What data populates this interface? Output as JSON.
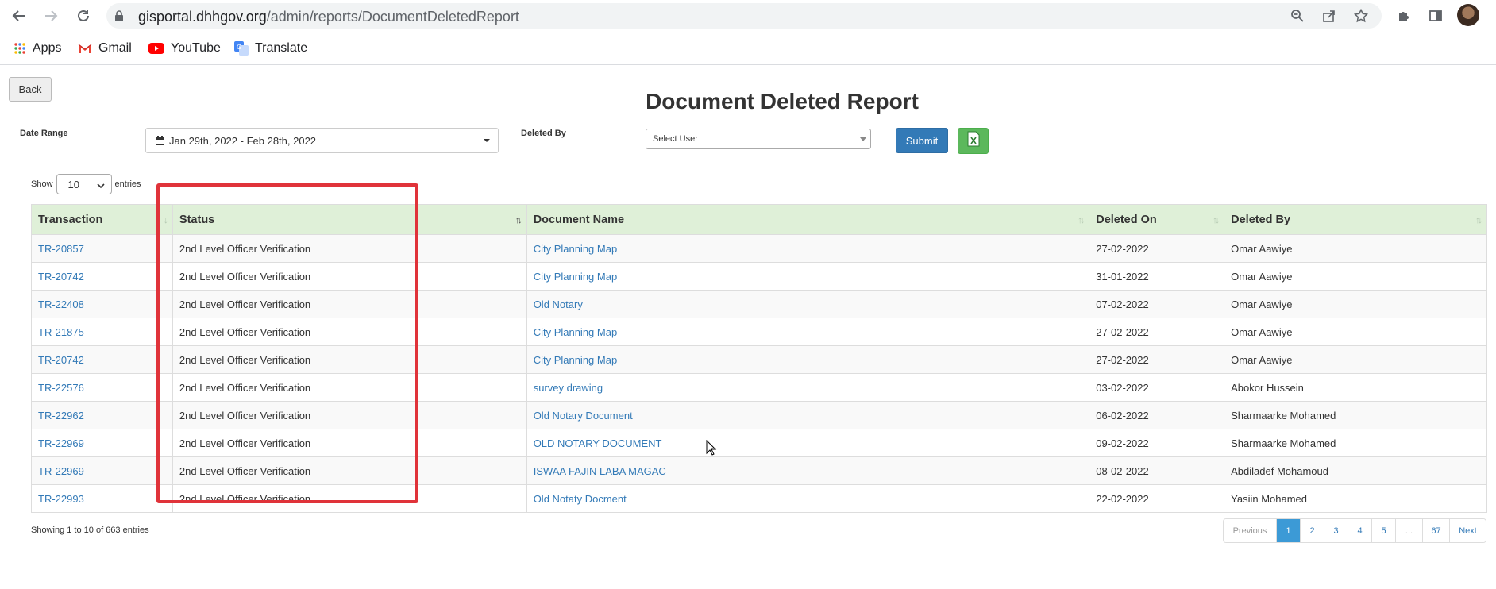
{
  "browser": {
    "url_host": "gisportal.dhhgov.org",
    "url_path": "/admin/reports/DocumentDeletedReport",
    "bookmarks": [
      {
        "label": "Apps",
        "icon": "apps-grid-icon"
      },
      {
        "label": "Gmail",
        "icon": "gmail-icon"
      },
      {
        "label": "YouTube",
        "icon": "youtube-icon"
      },
      {
        "label": "Translate",
        "icon": "translate-icon"
      }
    ]
  },
  "page": {
    "back_label": "Back",
    "title": "Document Deleted Report",
    "date_range_label": "Date Range",
    "date_range_value": "Jan 29th, 2022 - Feb 28th, 2022",
    "deleted_by_label": "Deleted By",
    "deleted_by_select": "Select User",
    "submit_label": "Submit",
    "excel_icon": "excel-export-icon"
  },
  "table": {
    "show_label": "Show",
    "page_length": "10",
    "entries_label": "entries",
    "columns": [
      "Transaction",
      "Status",
      "Document Name",
      "Deleted On",
      "Deleted By"
    ],
    "rows": [
      [
        "TR-20857",
        "2nd Level Officer Verification",
        "City Planning Map",
        "27-02-2022",
        "Omar Aawiye"
      ],
      [
        "TR-20742",
        "2nd Level Officer Verification",
        "City Planning Map",
        "31-01-2022",
        "Omar Aawiye"
      ],
      [
        "TR-22408",
        "2nd Level Officer Verification",
        "Old Notary",
        "07-02-2022",
        "Omar Aawiye"
      ],
      [
        "TR-21875",
        "2nd Level Officer Verification",
        "City Planning Map",
        "27-02-2022",
        "Omar Aawiye"
      ],
      [
        "TR-20742",
        "2nd Level Officer Verification",
        "City Planning Map",
        "27-02-2022",
        "Omar Aawiye"
      ],
      [
        "TR-22576",
        "2nd Level Officer Verification",
        "survey drawing",
        "03-02-2022",
        "Abokor Hussein"
      ],
      [
        "TR-22962",
        "2nd Level Officer Verification",
        "Old Notary Document",
        "06-02-2022",
        "Sharmaarke Mohamed"
      ],
      [
        "TR-22969",
        "2nd Level Officer Verification",
        "OLD NOTARY DOCUMENT",
        "09-02-2022",
        "Sharmaarke Mohamed"
      ],
      [
        "TR-22969",
        "2nd Level Officer Verification",
        "ISWAA FAJIN LABA MAGAC",
        "08-02-2022",
        "Abdiladef Mohamoud"
      ],
      [
        "TR-22993",
        "2nd Level Officer Verification",
        "Old Notaty Docment",
        "22-02-2022",
        "Yasiin Mohamed"
      ]
    ],
    "info": "Showing 1 to 10 of 663 entries",
    "pagination": [
      "Previous",
      "1",
      "2",
      "3",
      "4",
      "5",
      "...",
      "67",
      "Next"
    ],
    "active_page": "1"
  },
  "colors": {
    "header_bg": "#dff0d8",
    "link": "#337ab7",
    "highlight": "#e0333a",
    "submit": "#337ab7",
    "excel": "#5cb85c"
  }
}
